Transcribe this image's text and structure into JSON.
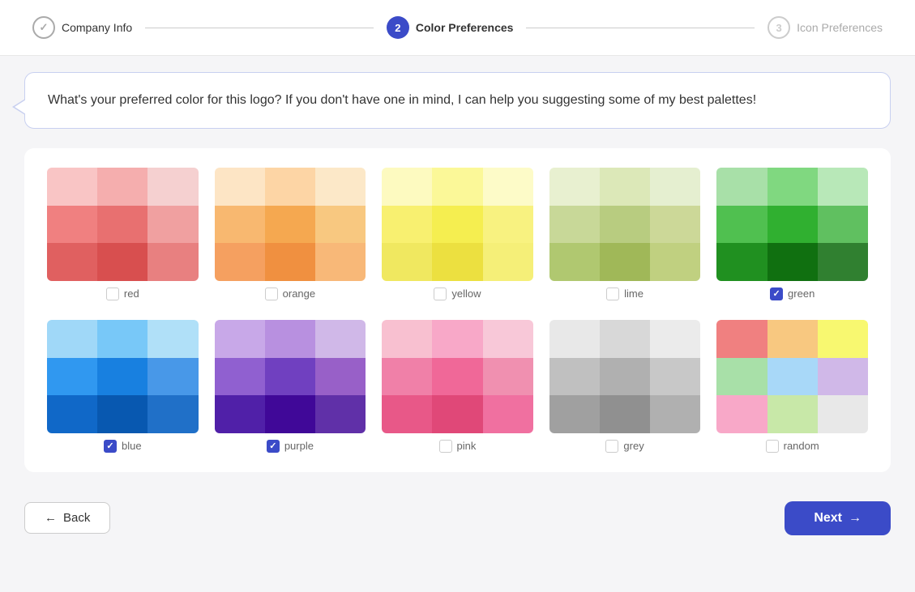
{
  "stepper": {
    "steps": [
      {
        "id": "company-info",
        "number": "✓",
        "label": "Company Info",
        "state": "done"
      },
      {
        "id": "color-preferences",
        "number": "2",
        "label": "Color Preferences",
        "state": "active"
      },
      {
        "id": "icon-preferences",
        "number": "3",
        "label": "Icon Preferences",
        "state": "inactive"
      }
    ]
  },
  "speech_bubble": {
    "text": "What's your preferred color for this logo? If you don't have one in mind, I can help you suggesting some of my best palettes!"
  },
  "color_palettes": [
    {
      "id": "red",
      "label": "red",
      "checked": false,
      "swatches": [
        "#f9c5c5",
        "#f5aeae",
        "#f5d0d0",
        "#f08080",
        "#e87070",
        "#f0a0a0",
        "#e06060",
        "#d84f4f",
        "#e88080"
      ]
    },
    {
      "id": "orange",
      "label": "orange",
      "checked": false,
      "swatches": [
        "#fde5c5",
        "#fdd5a5",
        "#fce8c8",
        "#f8b870",
        "#f5a850",
        "#f8c880",
        "#f5a060",
        "#f09040",
        "#f8b878"
      ]
    },
    {
      "id": "yellow",
      "label": "yellow",
      "checked": false,
      "swatches": [
        "#fdfac0",
        "#fbf898",
        "#fdfbc8",
        "#f8f070",
        "#f5ee50",
        "#f8f280",
        "#f0e860",
        "#ece040",
        "#f5ef78"
      ]
    },
    {
      "id": "lime",
      "label": "lime",
      "checked": false,
      "swatches": [
        "#e8f0d0",
        "#dce8b8",
        "#e5efd0",
        "#c8d898",
        "#b8cc80",
        "#ccd898",
        "#b0c870",
        "#a0b858",
        "#c0d080"
      ]
    },
    {
      "id": "green",
      "label": "green",
      "checked": true,
      "swatches": [
        "#a8e0a8",
        "#80d880",
        "#b8e8b8",
        "#50c050",
        "#30b030",
        "#60c060",
        "#209020",
        "#107010",
        "#308030"
      ]
    },
    {
      "id": "blue",
      "label": "blue",
      "checked": true,
      "swatches": [
        "#a0d8f8",
        "#78c8f8",
        "#b0e0f8",
        "#3098f0",
        "#1880e0",
        "#4898e8",
        "#1068c8",
        "#0858b0",
        "#2070c8"
      ]
    },
    {
      "id": "purple",
      "label": "purple",
      "checked": true,
      "swatches": [
        "#c8a8e8",
        "#b890e0",
        "#d0b8e8",
        "#9060d0",
        "#7040c0",
        "#9860c8",
        "#5020a8",
        "#400898",
        "#6030a8"
      ]
    },
    {
      "id": "pink",
      "label": "pink",
      "checked": false,
      "swatches": [
        "#f8c0d0",
        "#f8a8c8",
        "#f8c8d8",
        "#f080a8",
        "#f06898",
        "#f090b0",
        "#e85888",
        "#e04878",
        "#f070a0"
      ]
    },
    {
      "id": "grey",
      "label": "grey",
      "checked": false,
      "swatches": [
        "#e8e8e8",
        "#d8d8d8",
        "#ebebeb",
        "#c0c0c0",
        "#b0b0b0",
        "#c8c8c8",
        "#a0a0a0",
        "#909090",
        "#b0b0b0"
      ]
    },
    {
      "id": "random",
      "label": "random",
      "checked": false,
      "swatches": [
        "#f08080",
        "#f8c880",
        "#f8f870",
        "#a8e0a8",
        "#a8d8f8",
        "#d0b8e8",
        "#f8a8c8",
        "#c8e8a8",
        "#e8e8e8"
      ]
    }
  ],
  "buttons": {
    "back_label": "Back",
    "next_label": "Next",
    "back_arrow": "←",
    "next_arrow": "→"
  }
}
